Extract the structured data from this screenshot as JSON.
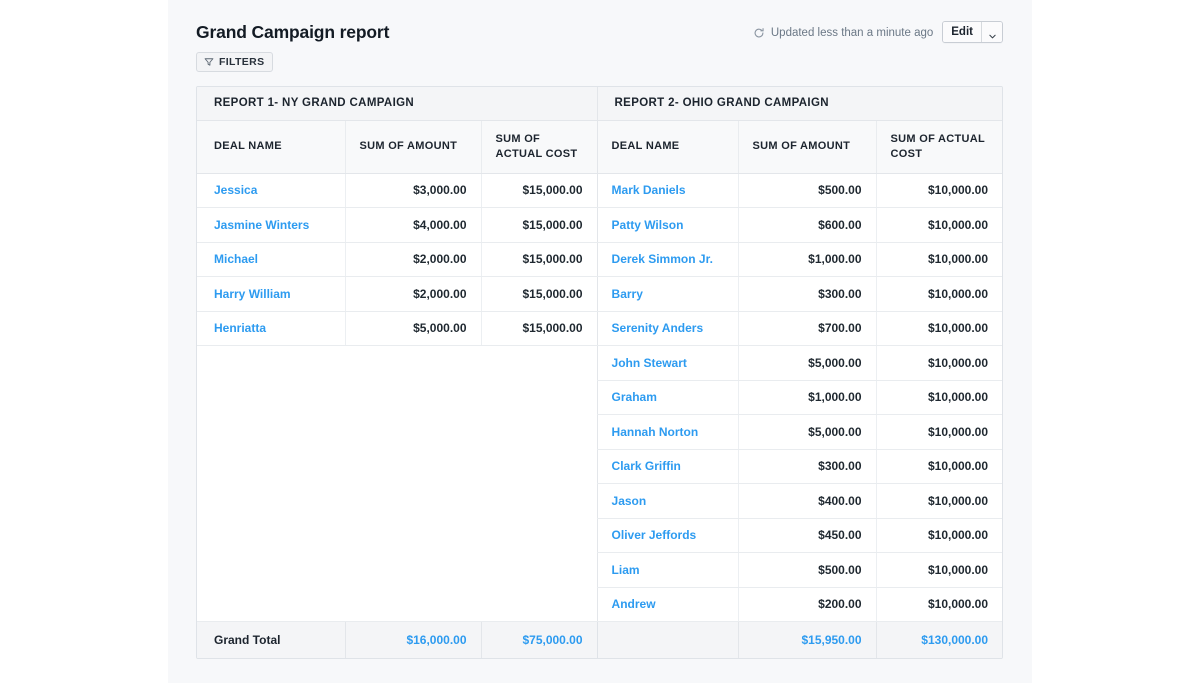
{
  "header": {
    "title": "Grand Campaign report",
    "updated_text": "Updated less than a minute ago",
    "refresh_icon": "refresh-icon",
    "edit_label": "Edit",
    "caret_icon": "chevron-down-icon"
  },
  "filters": {
    "label": "FILTERS",
    "icon": "funnel-icon"
  },
  "reports": [
    {
      "title": "REPORT 1- NY GRAND CAMPAIGN",
      "columns": [
        "DEAL NAME",
        "SUM OF AMOUNT",
        "SUM OF\nACTUAL COST"
      ],
      "columns_display": [
        "DEAL NAME",
        "SUM OF AMOUNT",
        "SUM OF ACTUAL COST"
      ],
      "rows": [
        {
          "name": "Jessica",
          "amount": "$3,000.00",
          "actual_cost": "$15,000.00"
        },
        {
          "name": "Jasmine Winters",
          "amount": "$4,000.00",
          "actual_cost": "$15,000.00"
        },
        {
          "name": "Michael",
          "amount": "$2,000.00",
          "actual_cost": "$15,000.00"
        },
        {
          "name": "Harry William",
          "amount": "$2,000.00",
          "actual_cost": "$15,000.00"
        },
        {
          "name": "Henriatta",
          "amount": "$5,000.00",
          "actual_cost": "$15,000.00"
        }
      ],
      "total": {
        "amount": "$16,000.00",
        "actual_cost": "$75,000.00"
      }
    },
    {
      "title": "REPORT 2- OHIO GRAND CAMPAIGN",
      "columns_display": [
        "DEAL NAME",
        "SUM OF AMOUNT",
        "SUM OF ACTUAL COST"
      ],
      "rows": [
        {
          "name": "Mark Daniels",
          "amount": "$500.00",
          "actual_cost": "$10,000.00"
        },
        {
          "name": "Patty Wilson",
          "amount": "$600.00",
          "actual_cost": "$10,000.00"
        },
        {
          "name": "Derek Simmon Jr.",
          "amount": "$1,000.00",
          "actual_cost": "$10,000.00"
        },
        {
          "name": "Barry",
          "amount": "$300.00",
          "actual_cost": "$10,000.00"
        },
        {
          "name": "Serenity Anders",
          "amount": "$700.00",
          "actual_cost": "$10,000.00"
        },
        {
          "name": "John Stewart",
          "amount": "$5,000.00",
          "actual_cost": "$10,000.00"
        },
        {
          "name": "Graham",
          "amount": "$1,000.00",
          "actual_cost": "$10,000.00"
        },
        {
          "name": "Hannah Norton",
          "amount": "$5,000.00",
          "actual_cost": "$10,000.00"
        },
        {
          "name": "Clark Griffin",
          "amount": "$300.00",
          "actual_cost": "$10,000.00"
        },
        {
          "name": "Jason",
          "amount": "$400.00",
          "actual_cost": "$10,000.00"
        },
        {
          "name": "Oliver Jeffords",
          "amount": "$450.00",
          "actual_cost": "$10,000.00"
        },
        {
          "name": "Liam",
          "amount": "$500.00",
          "actual_cost": "$10,000.00"
        },
        {
          "name": "Andrew",
          "amount": "$200.00",
          "actual_cost": "$10,000.00"
        }
      ],
      "total": {
        "name": "",
        "amount": "$15,950.00",
        "actual_cost": "$130,000.00"
      }
    }
  ],
  "grand_total_label": "Grand Total",
  "colors": {
    "link": "#2d9bf0",
    "panel_bg": "#f7f8fa",
    "header_bg": "#f4f5f7",
    "border": "#e3e6ea",
    "text": "#1c242e"
  }
}
